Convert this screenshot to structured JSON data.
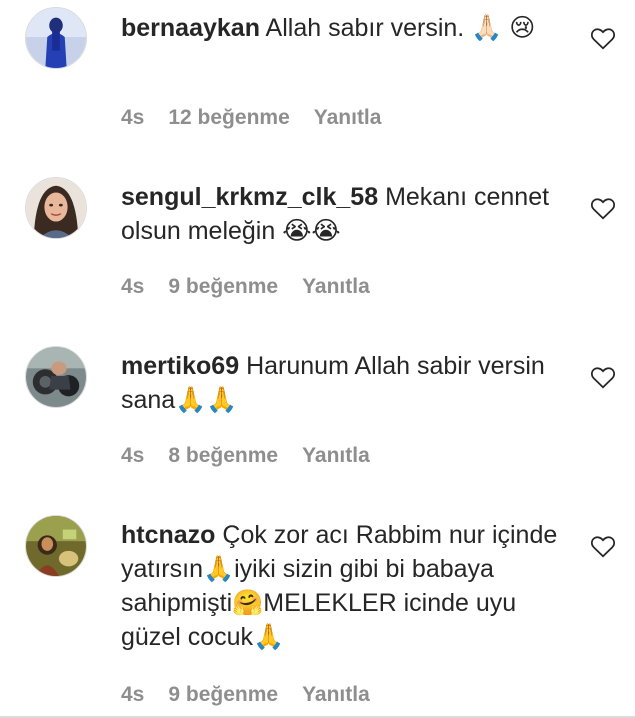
{
  "comments": [
    {
      "username": "bernaaykan",
      "text": "Allah sabır versin. 🙏🏻 😢",
      "time": "4s",
      "likes": "12 beğenme",
      "reply": "Yanıtla"
    },
    {
      "username": "sengul_krkmz_clk_58",
      "text": "Mekanı cennet olsun meleğin 😭😭",
      "time": "4s",
      "likes": "9 beğenme",
      "reply": "Yanıtla"
    },
    {
      "username": "mertiko69",
      "text": "Harunum Allah sabir versin sana🙏🙏",
      "time": "4s",
      "likes": "8 beğenme",
      "reply": "Yanıtla"
    },
    {
      "username": "htcnazo",
      "text": "Çok zor acı Rabbim nur içinde yatırsın🙏iyiki sizin gibi bi babaya sahipmişti🤗MELEKLER icinde uyu güzel cocuk🙏",
      "time": "4s",
      "likes": "9 beğenme",
      "reply": "Yanıtla"
    }
  ],
  "icons": {
    "like": "heart-outline-icon"
  },
  "colors": {
    "text": "#262626",
    "meta": "#8e8e8e",
    "border": "#dbdbdb"
  }
}
